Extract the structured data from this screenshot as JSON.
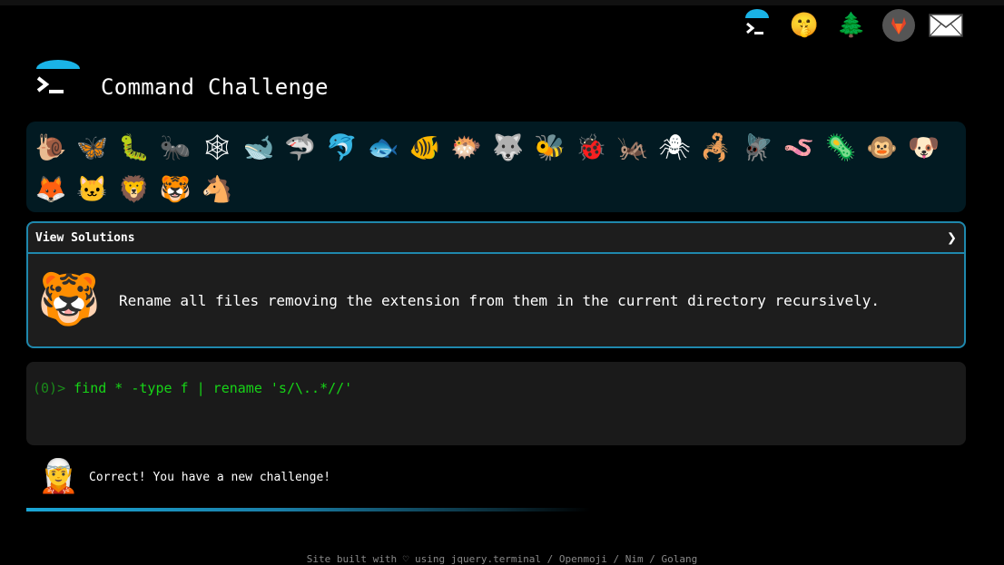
{
  "header": {
    "title": "Command Challenge"
  },
  "top_icons": [
    {
      "name": "terminal-logo-icon",
      "glyph": "›_"
    },
    {
      "name": "shushing-face-icon",
      "glyph": "🤫"
    },
    {
      "name": "tree-icon",
      "glyph": "🌲"
    },
    {
      "name": "gitlab-icon",
      "glyph": "🦊"
    },
    {
      "name": "mail-icon",
      "glyph": "✉"
    }
  ],
  "animals": [
    {
      "name": "snail",
      "glyph": "🐌"
    },
    {
      "name": "butterfly",
      "glyph": "🦋"
    },
    {
      "name": "caterpillar",
      "glyph": "🐛"
    },
    {
      "name": "ant",
      "glyph": "🐜"
    },
    {
      "name": "spider-web",
      "glyph": "🕸"
    },
    {
      "name": "whale",
      "glyph": "🐋"
    },
    {
      "name": "shark",
      "glyph": "🦈"
    },
    {
      "name": "dolphin",
      "glyph": "🐬"
    },
    {
      "name": "fish",
      "glyph": "🐟"
    },
    {
      "name": "tropical-fish",
      "glyph": "🐠"
    },
    {
      "name": "blowfish",
      "glyph": "🐡"
    },
    {
      "name": "wolf",
      "glyph": "🐺"
    },
    {
      "name": "bee",
      "glyph": "🐝"
    },
    {
      "name": "ladybug",
      "glyph": "🐞"
    },
    {
      "name": "cricket",
      "glyph": "🦗"
    },
    {
      "name": "spider",
      "glyph": "🕷"
    },
    {
      "name": "scorpion",
      "glyph": "🦂"
    },
    {
      "name": "fly",
      "glyph": "🪰"
    },
    {
      "name": "worm",
      "glyph": "🪱"
    },
    {
      "name": "microbe",
      "glyph": "🦠"
    },
    {
      "name": "monkey",
      "glyph": "🐵"
    },
    {
      "name": "dog",
      "glyph": "🐶"
    },
    {
      "name": "fox",
      "glyph": "🦊"
    },
    {
      "name": "cat",
      "glyph": "🐱"
    },
    {
      "name": "lion",
      "glyph": "🦁"
    },
    {
      "name": "tiger",
      "glyph": "🐯"
    },
    {
      "name": "horse",
      "glyph": "🐴"
    }
  ],
  "solutions": {
    "title": "View Solutions",
    "chevron": "❯",
    "animal_glyph": "🐯",
    "challenge_text": "Rename all files removing the extension from them in the current directory recursively."
  },
  "terminal": {
    "prompt_prefix": "(0)>",
    "command": "find * -type f | rename 's/\\..*//'"
  },
  "result": {
    "avatar_glyph": "🧝",
    "message": "Correct! You have a new challenge!",
    "progress": 0.6
  },
  "footer": {
    "text": "Site built with ♡ using jquery.terminal / Openmoji / Nim / Golang"
  },
  "colors": {
    "accent": "#1f88ad",
    "prompt_green": "#17d417",
    "strip_bg": "#021a22"
  }
}
